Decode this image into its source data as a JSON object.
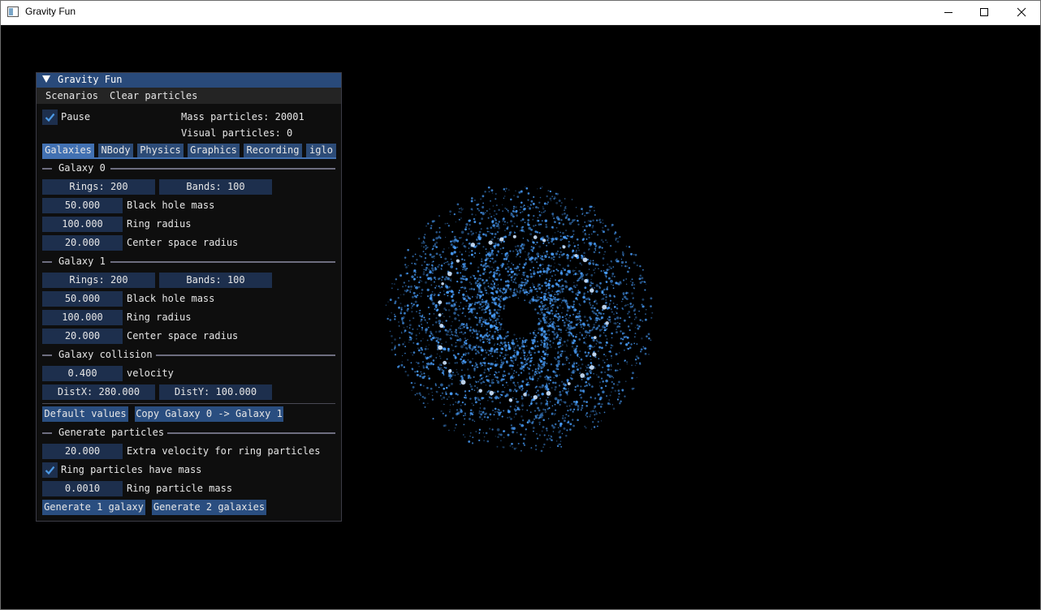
{
  "window": {
    "title": "Gravity Fun"
  },
  "panel": {
    "title": "Gravity Fun",
    "menu": [
      "Scenarios",
      "Clear particles"
    ],
    "pause_label": "Pause",
    "pause_checked": true,
    "mass_particles": "Mass particles: 20001",
    "visual_particles": "Visual particles: 0",
    "tabs": [
      "Galaxies",
      "NBody",
      "Physics",
      "Graphics",
      "Recording",
      "iglo"
    ],
    "active_tab": "Galaxies",
    "galaxy0": {
      "header": "Galaxy 0",
      "rings": "Rings: 200",
      "bands": "Bands: 100",
      "black_hole_mass": "50.000",
      "black_hole_mass_label": "Black hole mass",
      "ring_radius": "100.000",
      "ring_radius_label": "Ring radius",
      "center_space_radius": "20.000",
      "center_space_radius_label": "Center space radius"
    },
    "galaxy1": {
      "header": "Galaxy 1",
      "rings": "Rings: 200",
      "bands": "Bands: 100",
      "black_hole_mass": "50.000",
      "black_hole_mass_label": "Black hole mass",
      "ring_radius": "100.000",
      "ring_radius_label": "Ring radius",
      "center_space_radius": "20.000",
      "center_space_radius_label": "Center space radius"
    },
    "collision": {
      "header": "Galaxy collision",
      "velocity": "0.400",
      "velocity_label": "velocity",
      "dist_x": "DistX: 280.000",
      "dist_y": "DistY: 100.000"
    },
    "default_values_button": "Default values",
    "copy_button": "Copy Galaxy 0 -> Galaxy 1",
    "generate": {
      "header": "Generate particles",
      "extra_velocity": "20.000",
      "extra_velocity_label": "Extra velocity for ring particles",
      "ring_mass_checkbox_label": "Ring particles have mass",
      "ring_mass_checked": true,
      "ring_particle_mass": "0.0010",
      "ring_particle_mass_label": "Ring particle mass",
      "generate_one_button": "Generate 1 galaxy",
      "generate_two_button": "Generate 2 galaxies"
    }
  },
  "colors": {
    "title_bg": "#294a7a",
    "frame_bg": "#1d2f4d",
    "button_bg": "#2a4e80",
    "tab_active": "#4271b2",
    "particle_blue": "#4aa0ff"
  }
}
